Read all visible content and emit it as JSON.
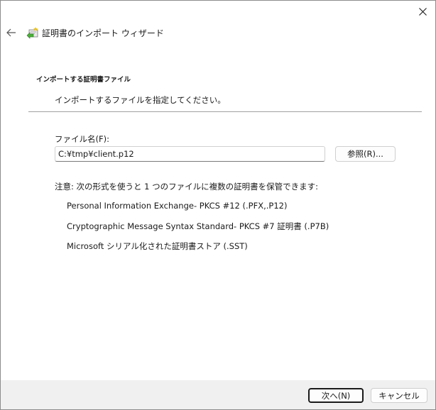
{
  "window": {
    "title": "証明書のインポート ウィザード"
  },
  "page": {
    "heading": "インポートする証明書ファイル",
    "description": "インポートするファイルを指定してください。"
  },
  "file": {
    "label": "ファイル名(F):",
    "value": "C:¥tmp¥client.p12",
    "browse_label": "参照(R)..."
  },
  "note": "注意: 次の形式を使うと 1 つのファイルに複数の証明書を保管できます:",
  "formats": [
    "Personal Information Exchange- PKCS #12 (.PFX,.P12)",
    "Cryptographic Message Syntax Standard- PKCS #7 証明書 (.P7B)",
    "Microsoft シリアル化された証明書ストア (.SST)"
  ],
  "footer": {
    "next_label": "次へ(N)",
    "cancel_label": "キャンセル"
  },
  "icons": {
    "close": "close-icon",
    "back": "back-arrow-icon",
    "wizard": "certificate-wizard-icon"
  },
  "colors": {
    "accent": "#1a1a1a",
    "footer_bg": "#f0f0f0",
    "wizard_icon_green": "#4caf3a"
  }
}
